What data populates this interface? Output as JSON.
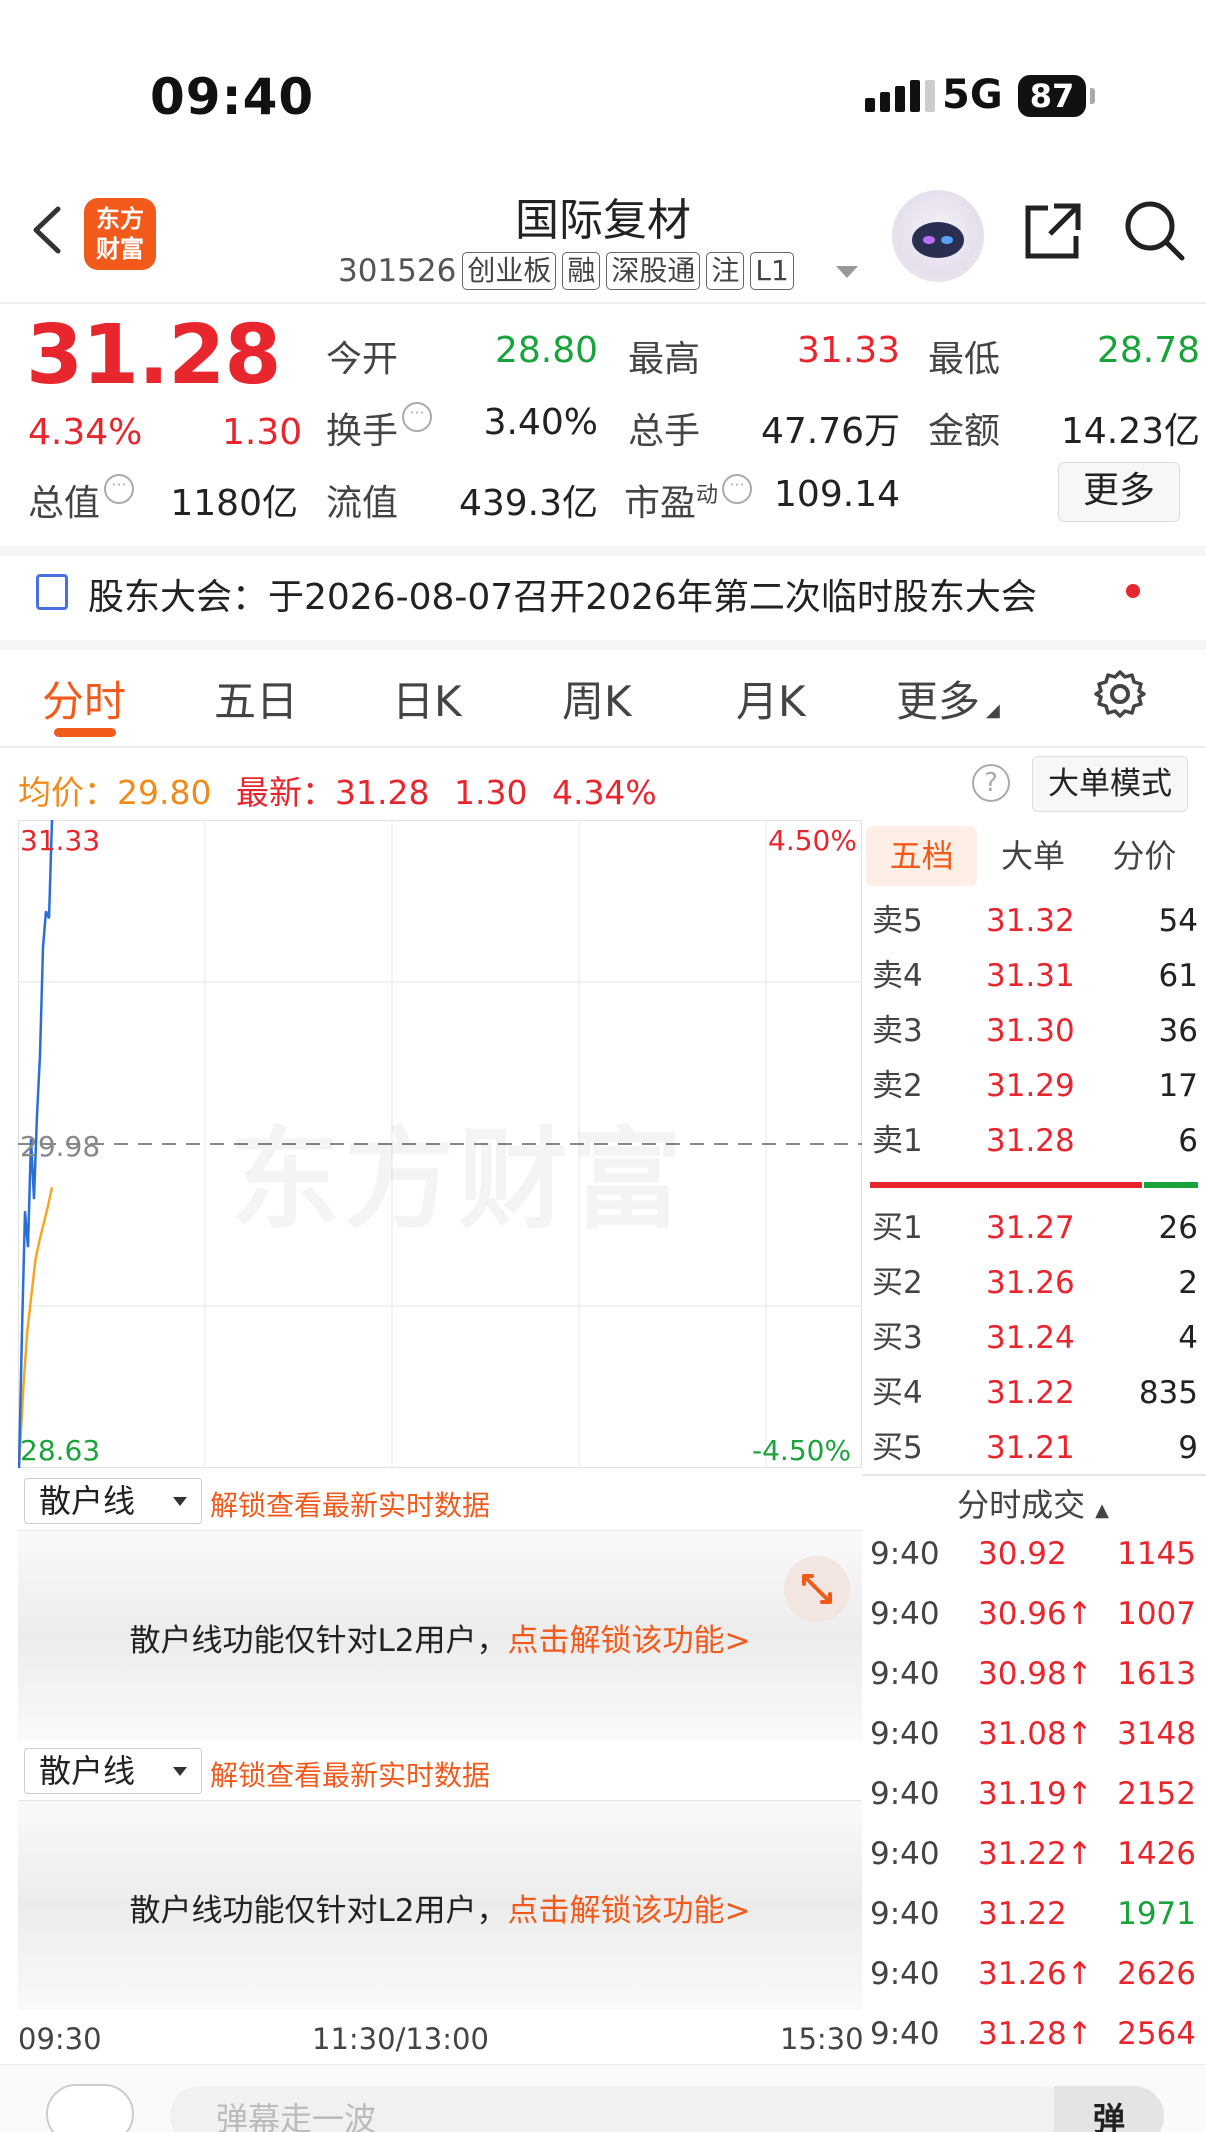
{
  "status_bar": {
    "time": "09:40",
    "network": "5G",
    "battery": "87"
  },
  "header": {
    "title": "国际复材",
    "code": "301526",
    "tags": [
      "创业板",
      "融",
      "深股通",
      "注",
      "L1"
    ],
    "logo_line1": "东方",
    "logo_line2": "财富"
  },
  "quote": {
    "price": "31.28",
    "change_pct": "4.34%",
    "change": "1.30",
    "fields": [
      {
        "label": "今开",
        "value": "28.80",
        "color": "#1aa33a"
      },
      {
        "label": "最高",
        "value": "31.33",
        "color": "#e8262e"
      },
      {
        "label": "最低",
        "value": "28.78",
        "color": "#1aa33a"
      },
      {
        "label": "换手",
        "value": "3.40%",
        "color": "#222222"
      },
      {
        "label": "总手",
        "value": "47.76万",
        "color": "#222222"
      },
      {
        "label": "金额",
        "value": "14.23亿",
        "color": "#222222"
      },
      {
        "label": "总值",
        "value": "1180亿",
        "color": "#222222"
      },
      {
        "label": "流值",
        "value": "439.3亿",
        "color": "#222222"
      },
      {
        "label": "市盈",
        "label_sup": "动",
        "value": "109.14",
        "color": "#222222"
      }
    ],
    "more_label": "更多"
  },
  "notice": {
    "text": "股东大会：于2026-08-07召开2026年第二次临时股东大会"
  },
  "tabs": [
    "分时",
    "五日",
    "日K",
    "周K",
    "月K",
    "更多"
  ],
  "price_line": {
    "avg_label": "均价：",
    "avg_value": "29.80",
    "latest_label": "最新：",
    "latest_value": "31.28",
    "latest_change": "1.30",
    "latest_pct": "4.34%",
    "help": "?",
    "big_order_mode": "大单模式"
  },
  "chart_labels": {
    "top_price": "31.33",
    "mid_price": "29.98",
    "bottom_price": "28.63",
    "top_pct": "4.50%",
    "bottom_pct": "-4.50%",
    "watermark": "东方财富",
    "time_start": "09:30",
    "time_mid": "11:30/13:00",
    "time_end": "15:30"
  },
  "chart_data": {
    "type": "line",
    "ylim": [
      28.63,
      31.33
    ],
    "series": [
      {
        "name": "最新",
        "color": "#2b6fd6",
        "values": [
          28.63,
          29.2,
          29.7,
          29.55,
          30.0,
          29.75,
          30.1,
          30.35,
          30.8,
          30.95,
          30.92,
          31.33
        ]
      },
      {
        "name": "均价",
        "color": "#f5a623",
        "values": [
          28.63,
          28.95,
          29.2,
          29.35,
          29.5,
          29.58,
          29.65,
          29.72,
          29.8
        ]
      }
    ]
  },
  "order_book": {
    "tabs": [
      "五档",
      "大单",
      "分价"
    ],
    "asks": [
      {
        "label": "卖5",
        "price": "31.32",
        "qty": "54"
      },
      {
        "label": "卖4",
        "price": "31.31",
        "qty": "61"
      },
      {
        "label": "卖3",
        "price": "31.30",
        "qty": "36"
      },
      {
        "label": "卖2",
        "price": "31.29",
        "qty": "17"
      },
      {
        "label": "卖1",
        "price": "31.28",
        "qty": "6"
      }
    ],
    "bids": [
      {
        "label": "买1",
        "price": "31.27",
        "qty": "26"
      },
      {
        "label": "买2",
        "price": "31.26",
        "qty": "2"
      },
      {
        "label": "买3",
        "price": "31.24",
        "qty": "4"
      },
      {
        "label": "买4",
        "price": "31.22",
        "qty": "835"
      },
      {
        "label": "买5",
        "price": "31.21",
        "qty": "9"
      }
    ]
  },
  "panels": [
    {
      "select": "散户线",
      "unlock": "解锁查看最新实时数据",
      "msg": "散户线功能仅针对L2用户，",
      "link": "点击解锁该功能>"
    },
    {
      "select": "散户线",
      "unlock": "解锁查看最新实时数据",
      "msg": "散户线功能仅针对L2用户，",
      "link": "点击解锁该功能>"
    }
  ],
  "trades": {
    "title": "分时成交",
    "rows": [
      {
        "time": "9:40",
        "price": "30.92",
        "vol": "1145",
        "pcolor": "#e8262e",
        "vcolor": "#e8262e"
      },
      {
        "time": "9:40",
        "price": "30.96↑",
        "vol": "1007",
        "pcolor": "#e8262e",
        "vcolor": "#e8262e"
      },
      {
        "time": "9:40",
        "price": "30.98↑",
        "vol": "1613",
        "pcolor": "#e8262e",
        "vcolor": "#e8262e"
      },
      {
        "time": "9:40",
        "price": "31.08↑",
        "vol": "3148",
        "pcolor": "#e8262e",
        "vcolor": "#e8262e"
      },
      {
        "time": "9:40",
        "price": "31.19↑",
        "vol": "2152",
        "pcolor": "#e8262e",
        "vcolor": "#e8262e"
      },
      {
        "time": "9:40",
        "price": "31.22↑",
        "vol": "1426",
        "pcolor": "#e8262e",
        "vcolor": "#e8262e"
      },
      {
        "time": "9:40",
        "price": "31.22",
        "vol": "1971",
        "pcolor": "#e8262e",
        "vcolor": "#1aa33a"
      },
      {
        "time": "9:40",
        "price": "31.26↑",
        "vol": "2626",
        "pcolor": "#e8262e",
        "vcolor": "#e8262e"
      },
      {
        "time": "9:40",
        "price": "31.28↑",
        "vol": "2564",
        "pcolor": "#e8262e",
        "vcolor": "#e8262e"
      }
    ]
  },
  "bottom": {
    "danmu_placeholder": "弹幕走一波",
    "danmu_button": "弹"
  }
}
